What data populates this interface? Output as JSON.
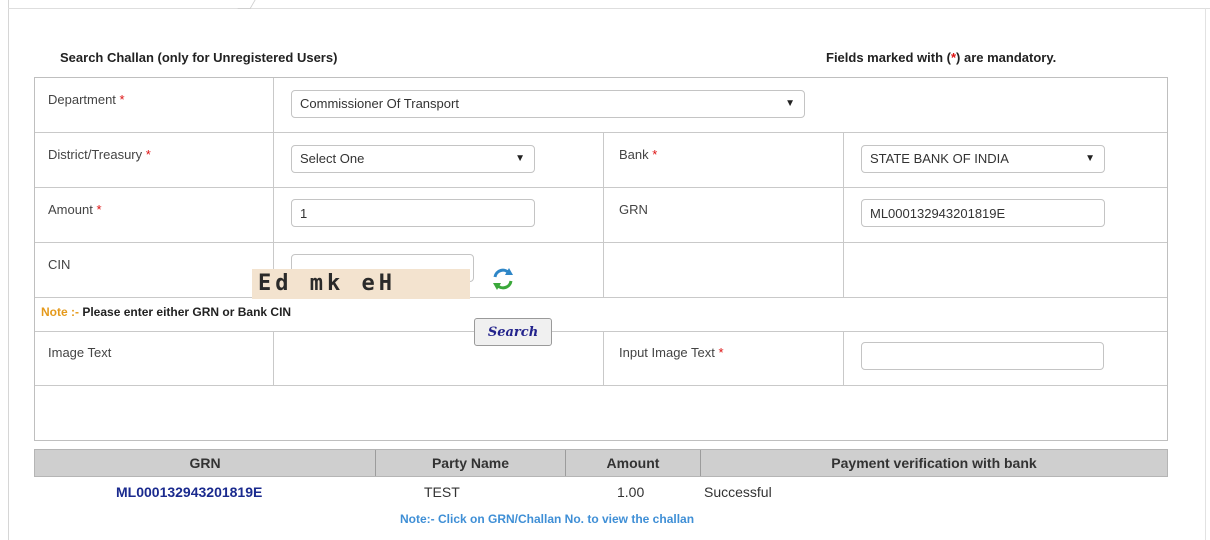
{
  "header": {
    "search_title": "Search Challan (only for Unregistered Users)",
    "mandatory_prefix": "Fields marked with (",
    "mandatory_star": "*",
    "mandatory_suffix": ") are mandatory."
  },
  "form": {
    "required_mark": "*",
    "department": {
      "label": "Department",
      "value": "Commissioner Of Transport"
    },
    "district": {
      "label": "District/Treasury",
      "value": "Select One"
    },
    "bank": {
      "label": "Bank",
      "value": "STATE BANK OF INDIA"
    },
    "amount": {
      "label": "Amount",
      "value": "1"
    },
    "grn": {
      "label": "GRN",
      "value": "ML000132943201819E"
    },
    "cin": {
      "label": "CIN",
      "value": ""
    },
    "note": {
      "prefix": "Note :-",
      "text": "Please enter either GRN or Bank CIN"
    },
    "image_text": {
      "label": "Image Text",
      "captcha": "Ed mk eH"
    },
    "input_image_text": {
      "label": "Input Image Text",
      "value": ""
    },
    "search_label": "Search"
  },
  "results": {
    "columns": [
      "GRN",
      "Party Name",
      "Amount",
      "Payment verification with bank"
    ],
    "rows": [
      {
        "grn": "ML000132943201819E",
        "party": "TEST",
        "amount": "1.00",
        "status": "Successful"
      }
    ],
    "footer_note": "Note:- Click on GRN/Challan No. to view the challan"
  },
  "colors": {
    "required": "#dd1111",
    "note_prefix": "#e59a1c",
    "link": "#1a2a8e",
    "header_bg": "#cfcfcf",
    "footer_note": "#3f8fd6"
  },
  "icons": {
    "refresh": "refresh-captcha-icon",
    "dropdown": "chevron-down-icon"
  }
}
